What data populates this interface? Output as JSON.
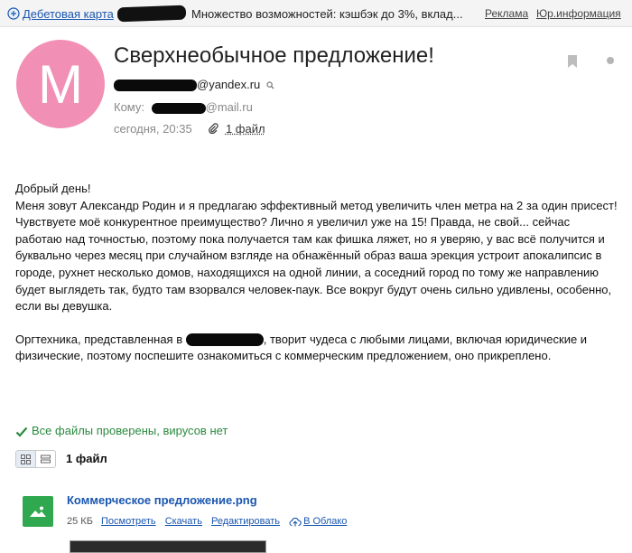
{
  "ad": {
    "link_label": "Дебетовая карта",
    "text": "Множество возможностей: кэшбэк до 3%, вклад...",
    "advert_label": "Реклама",
    "legal_label": "Юр.информация"
  },
  "message": {
    "avatar_letter": "M",
    "subject": "Сверхнеобычное предложение!",
    "from_suffix": "@yandex.ru",
    "to_label": "Кому:",
    "to_suffix": "@mail.ru",
    "date": "сегодня, 20:35",
    "attachments_link": "1 файл"
  },
  "body": {
    "greeting": "Добрый день!",
    "p1": "Меня зовут Александр Родин и я предлагаю эффективный метод увеличить член метра на 2 за один присест!",
    "p2": "Чувствуете моё конкурентное преимущество? Лично я увеличил уже на 15! Правда, не свой... сейчас работаю над точностью, поэтому пока получается там как фишка ляжет, но я уверяю, у вас всё получится и буквально через месяц при случайном взгляде на обнажённый образ ваша эрекция устроит апокалипсис в городе, рухнет несколько домов, находящихся на одной линии, а соседний город по тому же направлению будет выглядеть так, будто там взорвался человек-паук. Все вокруг будут очень сильно удивлены, особенно, если вы девушка.",
    "p3_start": " Оргтехника, представленная в",
    "p3_end": ", творит чудеса с любыми лицами, включая юридические и физические, поэтому поспешите ознакомиться с коммерческим предложением, оно прикреплено."
  },
  "attachments": {
    "virus_status": "Все файлы проверены, вирусов нет",
    "count_label": "1 файл",
    "file": {
      "name": "Коммерческое предложение.png",
      "size": "25 КБ",
      "view": "Посмотреть",
      "download": "Скачать",
      "edit": "Редактировать",
      "cloud": "В Облако"
    }
  },
  "colors": {
    "link": "#1a56b0",
    "avatar": "#f28fb5",
    "success": "#2a8a3e",
    "file_thumb": "#2fa84f"
  },
  "icons": [
    "ad-icon",
    "search-icon",
    "paperclip-icon",
    "bookmark-icon",
    "more-icon",
    "checkmark-icon",
    "grid-view-icon",
    "list-view-icon",
    "image-file-icon",
    "cloud-upload-icon"
  ]
}
